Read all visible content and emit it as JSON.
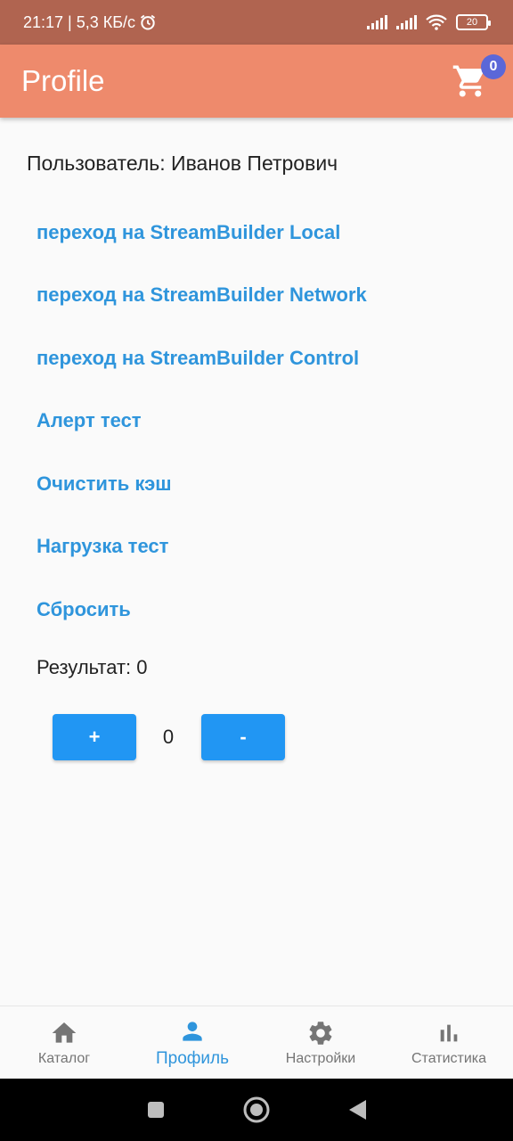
{
  "status": {
    "time_speed": "21:17 | 5,3 КБ/с",
    "battery": "20"
  },
  "appbar": {
    "title": "Profile",
    "cart_count": "0"
  },
  "profile": {
    "user_line": "Пользователь: Иванов Петрович"
  },
  "links": [
    "переход на StreamBuilder Local",
    "переход на StreamBuilder Network",
    "переход на StreamBuilder Control",
    "Алерт тест",
    "Очистить кэш",
    "Нагрузка тест",
    "Сбросить"
  ],
  "result": {
    "label": "Результат:  0"
  },
  "counter": {
    "plus": "+",
    "minus": "-",
    "value": "0"
  },
  "bottom_nav": [
    {
      "label": "Каталог",
      "icon": "home-icon",
      "active": false
    },
    {
      "label": "Профиль",
      "icon": "person-icon",
      "active": true
    },
    {
      "label": "Настройки",
      "icon": "gear-icon",
      "active": false
    },
    {
      "label": "Статистика",
      "icon": "bar-chart-icon",
      "active": false
    }
  ],
  "colors": {
    "status_bar": "#b06450",
    "app_bar": "#ee8a6c",
    "accent": "#2f95dc",
    "badge": "#5b67d8",
    "button": "#2196f3"
  }
}
